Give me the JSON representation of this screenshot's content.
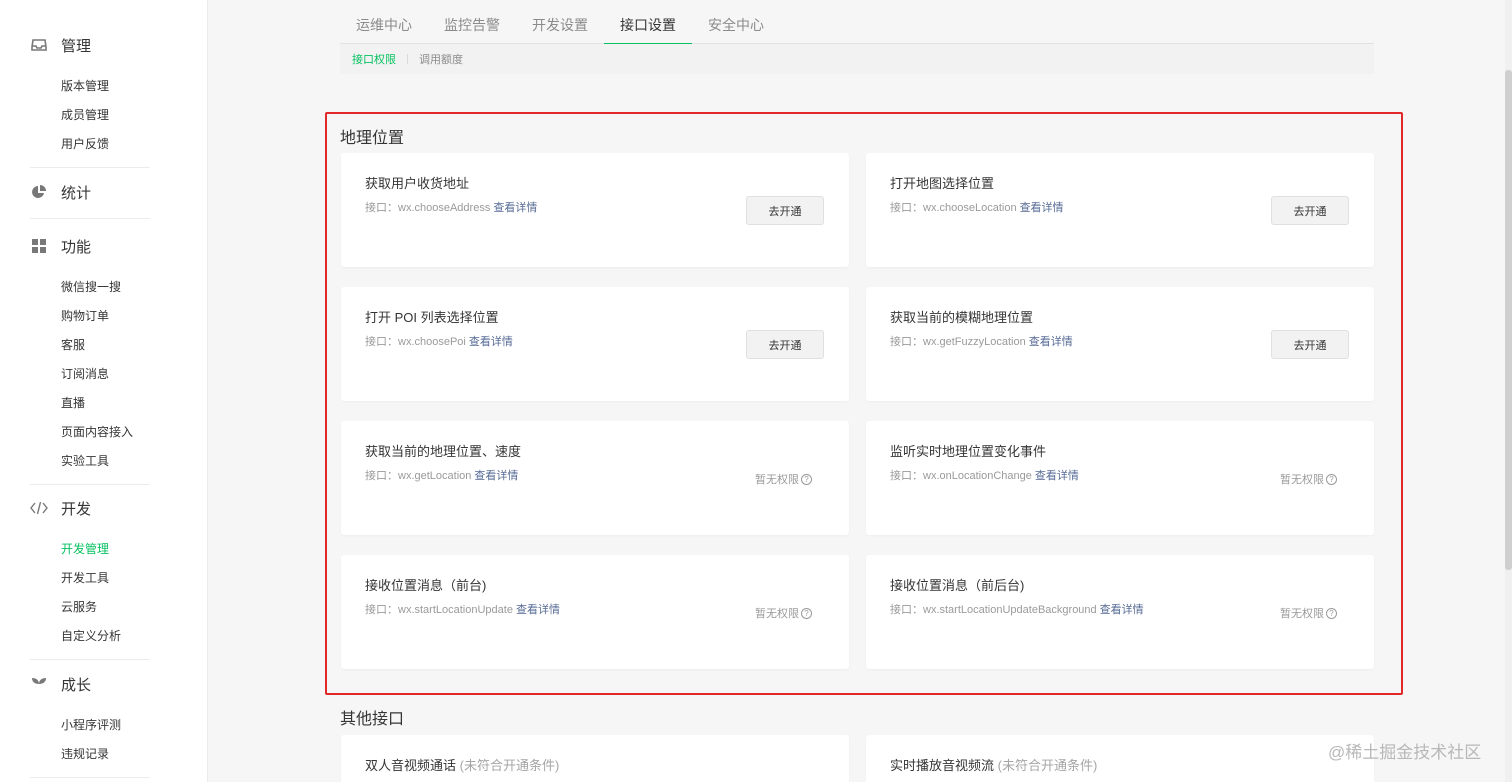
{
  "sidebar": {
    "groups": [
      {
        "title": "管理",
        "icon": "inbox-icon",
        "items": [
          "版本管理",
          "成员管理",
          "用户反馈"
        ]
      },
      {
        "title": "统计",
        "icon": "pie-chart-icon",
        "items": []
      },
      {
        "title": "功能",
        "icon": "grid-icon",
        "items": [
          "微信搜一搜",
          "购物订单",
          "客服",
          "订阅消息",
          "直播",
          "页面内容接入",
          "实验工具"
        ]
      },
      {
        "title": "开发",
        "icon": "code-icon",
        "items": [
          "开发管理",
          "开发工具",
          "云服务",
          "自定义分析"
        ],
        "active_item": "开发管理"
      },
      {
        "title": "成长",
        "icon": "leaf-icon",
        "items": [
          "小程序评测",
          "违规记录"
        ]
      }
    ]
  },
  "tabs": [
    "运维中心",
    "监控告警",
    "开发设置",
    "接口设置",
    "安全中心"
  ],
  "active_tab": "接口设置",
  "subtabs": [
    "接口权限",
    "调用额度"
  ],
  "active_subtab": "接口权限",
  "sections": {
    "geo_title": "地理位置",
    "other_title": "其他接口"
  },
  "common": {
    "api_prefix": "接口：",
    "detail_link": "查看详情",
    "open_button": "去开通",
    "no_permission": "暂无权限",
    "help_glyph": "?"
  },
  "geo_cards": [
    {
      "title": "获取用户收货地址",
      "api": "wx.chooseAddress",
      "action": "open"
    },
    {
      "title": "打开地图选择位置",
      "api": "wx.chooseLocation",
      "action": "open"
    },
    {
      "title": "打开 POI 列表选择位置",
      "api": "wx.choosePoi",
      "action": "open"
    },
    {
      "title": "获取当前的模糊地理位置",
      "api": "wx.getFuzzyLocation",
      "action": "open"
    },
    {
      "title": "获取当前的地理位置、速度",
      "api": "wx.getLocation",
      "action": "none"
    },
    {
      "title": "监听实时地理位置变化事件",
      "api": "wx.onLocationChange",
      "action": "none"
    },
    {
      "title": "接收位置消息（前台)",
      "api": "wx.startLocationUpdate",
      "action": "none"
    },
    {
      "title": "接收位置消息（前后台)",
      "api": "wx.startLocationUpdateBackground",
      "action": "none"
    }
  ],
  "other_cards": [
    {
      "title": "双人音视频通话",
      "subtitle": "(未符合开通条件)"
    },
    {
      "title": "实时播放音视频流",
      "subtitle": "(未符合开通条件)"
    }
  ],
  "watermark": "@稀土掘金技术社区",
  "colors": {
    "accent": "#07c160",
    "link": "#576b95",
    "highlight_border": "#e22929"
  }
}
